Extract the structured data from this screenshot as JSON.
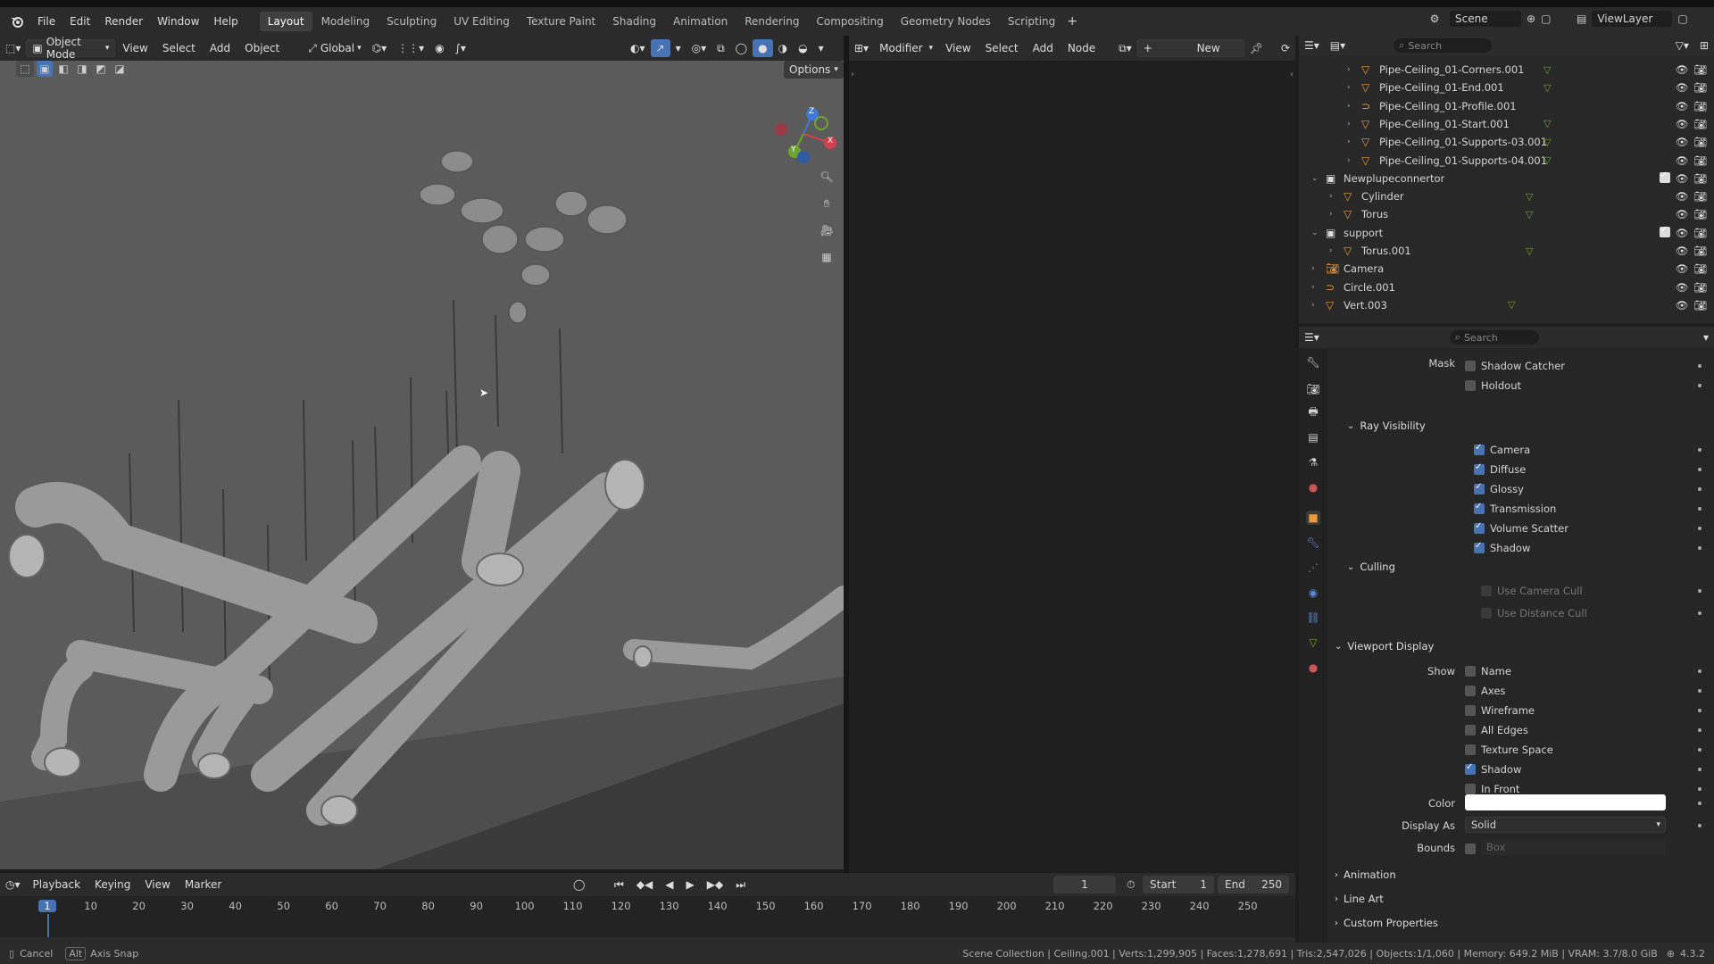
{
  "topbar": {
    "menus": [
      "File",
      "Edit",
      "Render",
      "Window",
      "Help"
    ],
    "workspaces": [
      "Layout",
      "Modeling",
      "Sculpting",
      "UV Editing",
      "Texture Paint",
      "Shading",
      "Animation",
      "Rendering",
      "Compositing",
      "Geometry Nodes",
      "Scripting"
    ],
    "active_workspace": "Layout",
    "scene": "Scene",
    "view_layer": "ViewLayer"
  },
  "viewport_header": {
    "mode": "Object Mode",
    "menus": [
      "View",
      "Select",
      "Add",
      "Object"
    ],
    "transform": "Global",
    "options": "Options"
  },
  "node_header": {
    "type": "Modifier",
    "menus": [
      "View",
      "Select",
      "Add",
      "Node"
    ],
    "new_label": "New"
  },
  "gizmo": {
    "z": "Z",
    "y": "Y",
    "x": "X"
  },
  "outliner": {
    "search_placeholder": "Search",
    "items": [
      {
        "name": "Pipe-Ceiling_01-Corners.001",
        "indent": 3,
        "kind": "mesh"
      },
      {
        "name": "Pipe-Ceiling_01-End.001",
        "indent": 3,
        "kind": "mesh"
      },
      {
        "name": "Pipe-Ceiling_01-Profile.001",
        "indent": 3,
        "kind": "curve"
      },
      {
        "name": "Pipe-Ceiling_01-Start.001",
        "indent": 3,
        "kind": "mesh"
      },
      {
        "name": "Pipe-Ceiling_01-Supports-03.001",
        "indent": 3,
        "kind": "mesh"
      },
      {
        "name": "Pipe-Ceiling_01-Supports-04.001",
        "indent": 3,
        "kind": "mesh"
      },
      {
        "name": "Newplupeconnertor",
        "indent": 1,
        "kind": "collection"
      },
      {
        "name": "Cylinder",
        "indent": 2,
        "kind": "mesh"
      },
      {
        "name": "Torus",
        "indent": 2,
        "kind": "mesh"
      },
      {
        "name": "support",
        "indent": 1,
        "kind": "collection"
      },
      {
        "name": "Torus.001",
        "indent": 2,
        "kind": "mesh"
      },
      {
        "name": "Camera",
        "indent": 1,
        "kind": "camera"
      },
      {
        "name": "Circle.001",
        "indent": 1,
        "kind": "curve"
      },
      {
        "name": "Vert.003",
        "indent": 1,
        "kind": "mesh"
      }
    ]
  },
  "properties": {
    "search_placeholder": "Search",
    "mask_label": "Mask",
    "mask_items": [
      {
        "label": "Shadow Catcher",
        "checked": false
      },
      {
        "label": "Holdout",
        "checked": false
      }
    ],
    "ray_visibility": {
      "title": "Ray Visibility",
      "items": [
        {
          "label": "Camera",
          "checked": true
        },
        {
          "label": "Diffuse",
          "checked": true
        },
        {
          "label": "Glossy",
          "checked": true
        },
        {
          "label": "Transmission",
          "checked": true
        },
        {
          "label": "Volume Scatter",
          "checked": true
        },
        {
          "label": "Shadow",
          "checked": true
        }
      ]
    },
    "culling": {
      "title": "Culling",
      "items": [
        {
          "label": "Use Camera Cull",
          "checked": false
        },
        {
          "label": "Use Distance Cull",
          "checked": false
        }
      ]
    },
    "viewport_display": {
      "title": "Viewport Display",
      "show_label": "Show",
      "items": [
        {
          "label": "Name",
          "checked": false
        },
        {
          "label": "Axes",
          "checked": false
        },
        {
          "label": "Wireframe",
          "checked": false
        },
        {
          "label": "All Edges",
          "checked": false
        },
        {
          "label": "Texture Space",
          "checked": false
        },
        {
          "label": "Shadow",
          "checked": true
        },
        {
          "label": "In Front",
          "checked": false
        }
      ],
      "color_label": "Color",
      "color_value": "#ffffff",
      "display_as_label": "Display As",
      "display_as_value": "Solid",
      "bounds_label": "Bounds",
      "bounds_value": "Box"
    },
    "collapsed_sections": [
      "Animation",
      "Line Art",
      "Custom Properties"
    ]
  },
  "timeline": {
    "menus": [
      "Playback",
      "Keying",
      "View",
      "Marker"
    ],
    "current_frame": "1",
    "start_label": "Start",
    "start_value": "1",
    "end_label": "End",
    "end_value": "250",
    "ruler": [
      "1",
      "10",
      "20",
      "30",
      "40",
      "50",
      "60",
      "70",
      "80",
      "90",
      "100",
      "110",
      "120",
      "130",
      "140",
      "150",
      "160",
      "170",
      "180",
      "190",
      "200",
      "210",
      "220",
      "230",
      "240",
      "250"
    ]
  },
  "statusbar": {
    "cancel": "Cancel",
    "alt_key": "Alt",
    "axis_snap": "Axis Snap",
    "info": "Scene Collection | Ceiling.001 | Verts:1,299,905 | Faces:1,278,691 | Tris:2,547,026 | Objects:1/1,060 | Memory: 649.2 MiB | VRAM: 3.7/8.0 GiB",
    "version": "4.3.2"
  },
  "colors": {
    "accent": "#4772b3",
    "x_axis": "#d4404d",
    "y_axis": "#6ea52d",
    "z_axis": "#3f78d6"
  }
}
